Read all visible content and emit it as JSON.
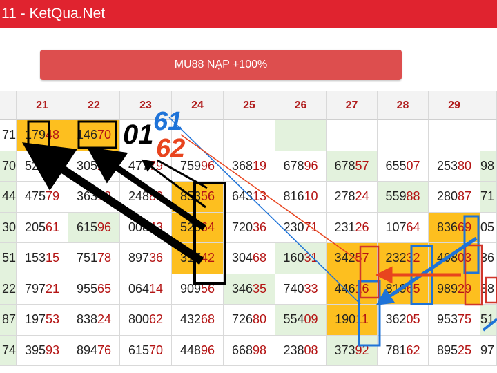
{
  "header": {
    "title": "11 - KetQua.Net"
  },
  "promo": {
    "label": "MU88 NẠP +100%"
  },
  "table": {
    "columns": [
      "",
      "21",
      "22",
      "23",
      "24",
      "25",
      "26",
      "27",
      "28",
      "29",
      ""
    ],
    "rows": [
      [
        "71",
        "17948",
        "14670",
        "",
        "",
        "",
        "",
        "",
        "",
        "",
        ""
      ],
      [
        "70",
        "52096",
        "30529",
        "47779",
        "75996",
        "36819",
        "67896",
        "67857",
        "65507",
        "25380",
        "98"
      ],
      [
        "44",
        "47579",
        "36318",
        "24880",
        "85356",
        "64313",
        "81610",
        "27824",
        "55988",
        "28087",
        "71"
      ],
      [
        "30",
        "20561",
        "61596",
        "00843",
        "52564",
        "72036",
        "23071",
        "23126",
        "10764",
        "83669",
        "05"
      ],
      [
        "51",
        "15315",
        "75178",
        "89736",
        "31742",
        "30468",
        "16031",
        "34257",
        "23232",
        "40803",
        "36"
      ],
      [
        "22",
        "79721",
        "95565",
        "06414",
        "90956",
        "34635",
        "74033",
        "44616",
        "81965",
        "98929",
        "88"
      ],
      [
        "87",
        "19753",
        "83824",
        "80062",
        "43268",
        "72680",
        "55409",
        "19011",
        "36205",
        "95375",
        "51"
      ],
      [
        "74",
        "39593",
        "89476",
        "61570",
        "44896",
        "66898",
        "23808",
        "37392",
        "78162",
        "89525",
        "97"
      ]
    ],
    "highlighted": [
      "0-1",
      "0-2",
      "2-4",
      "3-4",
      "4-4",
      "4-7",
      "4-8",
      "4-9",
      "5-7",
      "5-8",
      "5-9",
      "6-7",
      "3-9"
    ],
    "green": [
      "0-6",
      "1-7",
      "2-8",
      "3-2",
      "4-6",
      "5-5",
      "6-6",
      "7-7",
      "1-0",
      "2-0",
      "3-0",
      "4-0",
      "5-0",
      "6-0",
      "7-0",
      "1-10",
      "2-10",
      "6-10"
    ]
  },
  "annotations": {
    "text_01": "01",
    "text_61": "61",
    "text_62": "62",
    "colors": {
      "black": "#000000",
      "blue": "#1e73d8",
      "red": "#e8441e",
      "box_red": "#d0362b"
    }
  }
}
